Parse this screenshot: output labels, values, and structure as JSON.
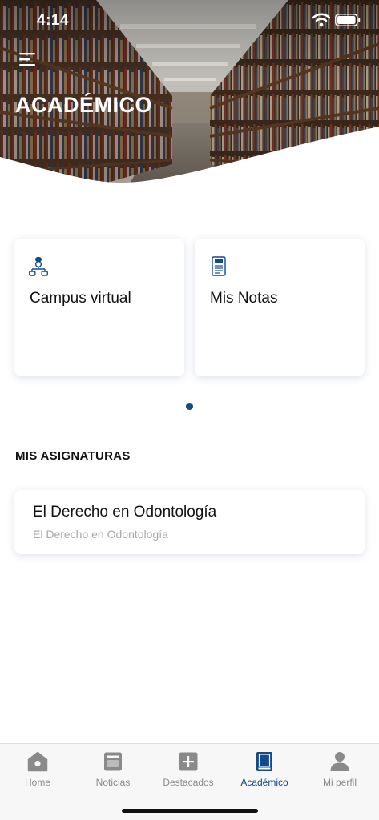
{
  "status_bar": {
    "time": "4:14"
  },
  "header": {
    "title": "ACADÉMICO"
  },
  "cards": [
    {
      "label": "Campus virtual",
      "icon": "campus-network-icon"
    },
    {
      "label": "Mis Notas",
      "icon": "grades-document-icon"
    }
  ],
  "pagination": {
    "current": 1,
    "total": 1
  },
  "subjects_section": {
    "title": "MIS ASIGNATURAS",
    "items": [
      {
        "title": "El Derecho en Odontología",
        "subtitle": "El Derecho en Odontología"
      }
    ]
  },
  "tabbar": {
    "tabs": [
      {
        "label": "Home",
        "icon": "home-icon",
        "active": false
      },
      {
        "label": "Noticias",
        "icon": "news-icon",
        "active": false
      },
      {
        "label": "Destacados",
        "icon": "plus-square-icon",
        "active": false
      },
      {
        "label": "Académico",
        "icon": "book-icon",
        "active": true
      },
      {
        "label": "Mi perfil",
        "icon": "person-icon",
        "active": false
      }
    ]
  },
  "colors": {
    "accent": "#134a8a",
    "inactive_tab": "#8a8a8a",
    "tabbar_background": "#f7f7f7",
    "subtitle": "#a9a9a9"
  }
}
